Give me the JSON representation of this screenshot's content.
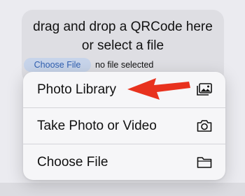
{
  "dropzone": {
    "line1": "drag and drop a QRCode here",
    "line2": "or select a file",
    "choose_button": "Choose File",
    "file_status": "no file selected"
  },
  "menu": {
    "items": [
      {
        "label": "Photo Library",
        "icon": "photo-library-icon"
      },
      {
        "label": "Take Photo or Video",
        "icon": "camera-icon"
      },
      {
        "label": "Choose File",
        "icon": "folder-icon"
      }
    ]
  },
  "annotation": {
    "arrow_color": "#e8321e",
    "points_to": "Photo Library"
  }
}
